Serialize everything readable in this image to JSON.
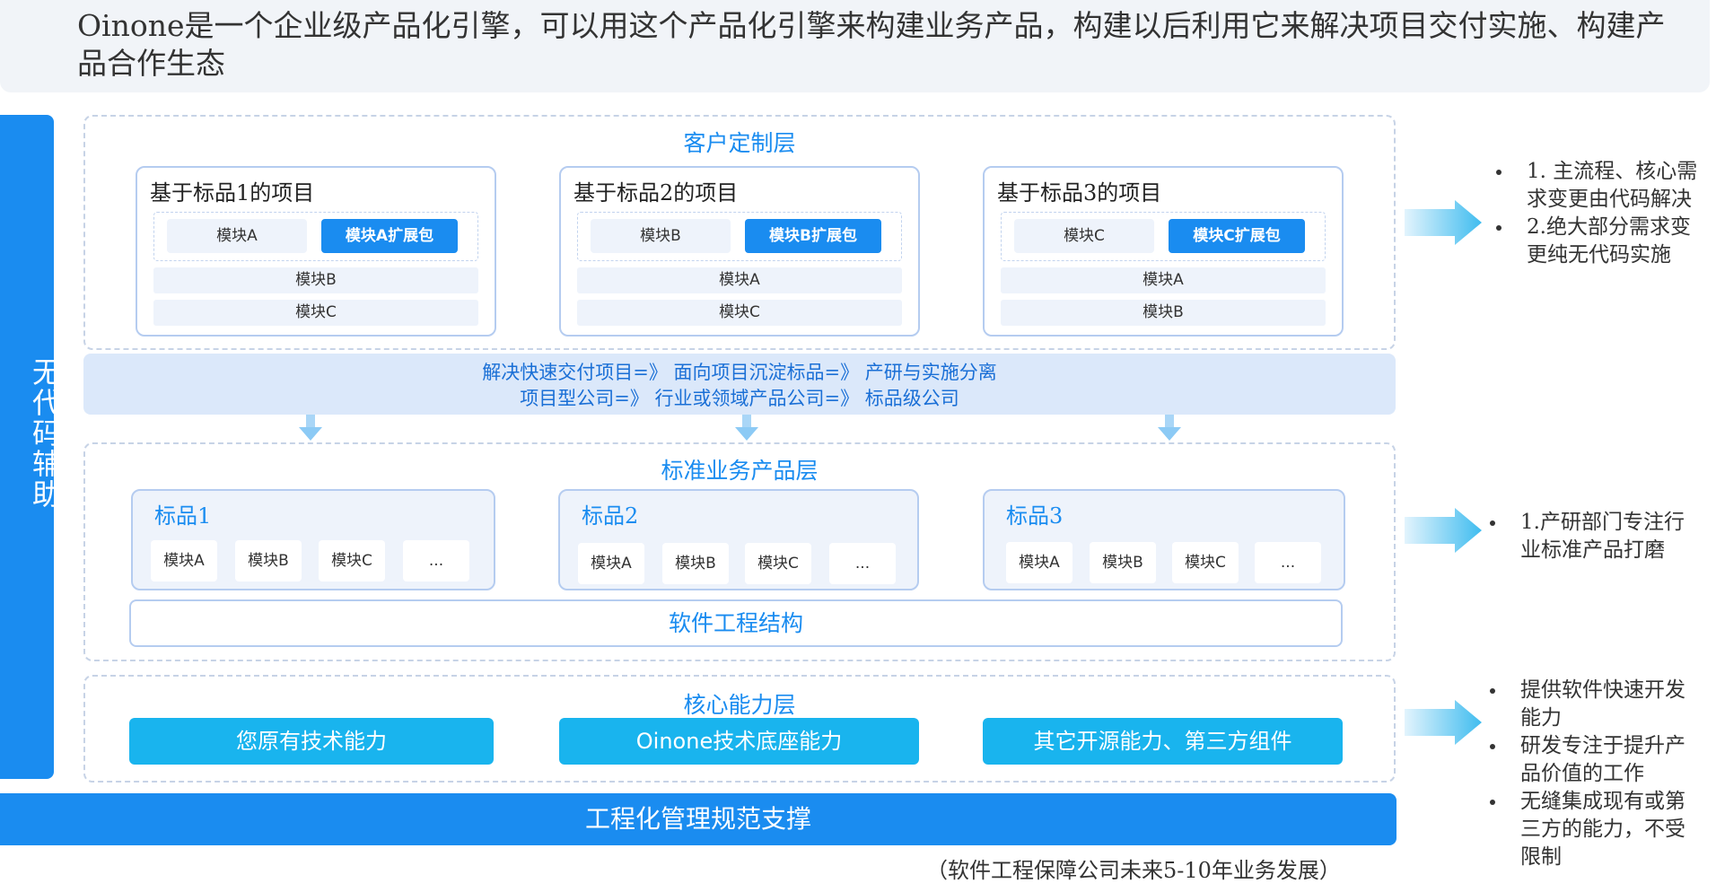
{
  "title": "Oinone是一个企业级产品化引擎，可以用这个产品化引擎来构建业务产品，构建以后利用它来解决项目交付实施、构建产品合作生态",
  "side_label": "无代码辅助",
  "customer_layer": {
    "title": "客户定制层",
    "projects": [
      {
        "title": "基于标品1的项目",
        "module": "模块A",
        "ext": "模块A扩展包",
        "rows": [
          "模块B",
          "模块C"
        ]
      },
      {
        "title": "基于标品2的项目",
        "module": "模块B",
        "ext": "模块B扩展包",
        "rows": [
          "模块A",
          "模块C"
        ]
      },
      {
        "title": "基于标品3的项目",
        "module": "模块C",
        "ext": "模块C扩展包",
        "rows": [
          "模块A",
          "模块B"
        ]
      }
    ]
  },
  "flow": {
    "line1": "解决快速交付项目=》 面向项目沉淀标品=》 产研与实施分离",
    "line2": "项目型公司=》 行业或领域产品公司=》 标品级公司"
  },
  "standard_layer": {
    "title": "标准业务产品层",
    "products": [
      {
        "title": "标品1",
        "modules": [
          "模块A",
          "模块B",
          "模块C",
          "..."
        ]
      },
      {
        "title": "标品2",
        "modules": [
          "模块A",
          "模块B",
          "模块C",
          "..."
        ]
      },
      {
        "title": "标品3",
        "modules": [
          "模块A",
          "模块B",
          "模块C",
          "..."
        ]
      }
    ],
    "software_structure": "软件工程结构"
  },
  "core_layer": {
    "title": "核心能力层",
    "items": [
      "您原有技术能力",
      "Oinone技术底座能力",
      "其它开源能力、第三方组件"
    ]
  },
  "support_bar": "工程化管理规范支撑",
  "footer_note": "（软件工程保障公司未来5-10年业务发展）",
  "notes": {
    "customer": [
      "1. 主流程、核心需求变更由代码解决",
      "2.绝大部分需求变更纯无代码实施"
    ],
    "standard": [
      "1.产研部门专注行业标准产品打磨"
    ],
    "core": [
      "提供软件快速开发能力",
      "研发专注于提升产品价值的工作",
      "无缝集成现有或第三方的能力，不受限制"
    ]
  },
  "colors": {
    "primary": "#1a8cf0",
    "core": "#19b4ee",
    "light_fill": "#eef3fb",
    "flow_fill": "#dbe8fa",
    "border": "#b5ccf0"
  },
  "icons": [
    "right-arrow-icon",
    "down-arrow-icon"
  ]
}
